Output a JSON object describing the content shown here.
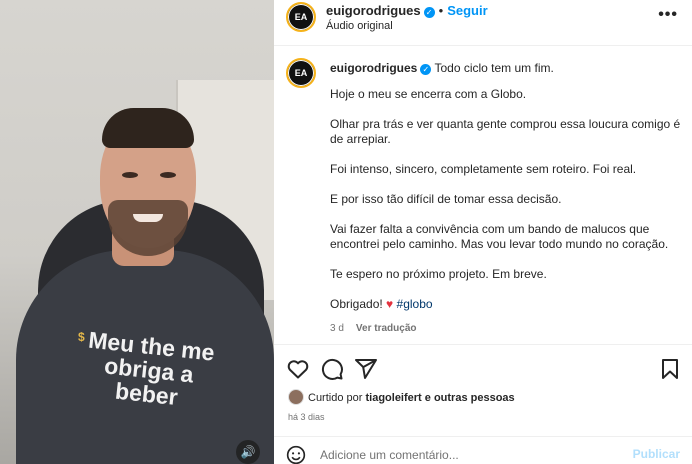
{
  "post": {
    "username": "euigorodrigues",
    "follow_label": "Seguir",
    "separator": "•",
    "audio_label": "Áudio original",
    "avatar_text": "EA",
    "more_icon": "more-horizontal-icon"
  },
  "caption": {
    "username": "euigorodrigues",
    "first_line": "Todo ciclo tem um fim.",
    "paragraphs": [
      "Hoje o meu se encerra com a Globo.",
      "Olhar pra trás e ver quanta gente comprou essa loucura comigo é de arrepiar.",
      "Foi intenso, sincero, completamente sem roteiro. Foi real.",
      "E por isso tão difícil de tomar essa decisão.",
      "Vai fazer falta a convivência com um bando de malucos que encontrei pelo caminho. Mas vou levar todo mundo no coração.",
      "Te espero no próximo projeto. Em breve."
    ],
    "closing": "Obrigado!",
    "emoji": "♥",
    "hashtag": "#globo",
    "age": "3 d",
    "translate_label": "Ver tradução"
  },
  "media": {
    "shirt_text": "Meu the me obriga a beber",
    "shirt_mark": "$",
    "volume_icon": "speaker-icon"
  },
  "likes": {
    "prefix": "Curtido por",
    "user": "tiagoleifert",
    "suffix": "e outras pessoas"
  },
  "date": "há 3 dias",
  "comment": {
    "placeholder": "Adicione um comentário...",
    "post_label": "Publicar"
  },
  "colors": {
    "accent": "#0095f6",
    "heart": "#e3323e",
    "hashtag": "#00376b",
    "post_disabled": "#b2dffc"
  }
}
